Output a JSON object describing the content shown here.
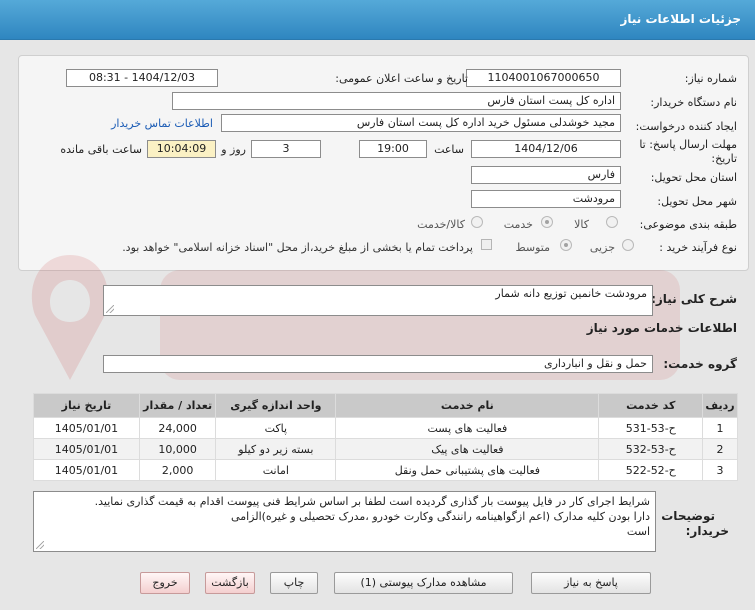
{
  "window": {
    "title": "جزئیات اطلاعات نیاز"
  },
  "form": {
    "need_number_label": "شماره نیاز:",
    "need_number": "1104001067000650",
    "announce_label": "تاریخ و ساعت اعلان عمومی:",
    "announce_value": "1404/12/03 - 08:31",
    "buyer_org_label": "نام دستگاه خریدار:",
    "buyer_org": "اداره کل پست استان فارس",
    "creator_label": "ایجاد کننده درخواست:",
    "creator": "مجید خوشدلی مسئول خرید اداره کل پست استان فارس",
    "contact_link": "اطلاعات تماس خریدار",
    "deadline_label_1": "مهلت ارسال پاسخ: تا",
    "deadline_label_2": "تاریخ:",
    "deadline_date": "1404/12/06",
    "time_label": "ساعت",
    "deadline_time": "19:00",
    "days_value": "3",
    "days_label": "روز و",
    "remaining_time": "10:04:09",
    "remaining_label": "ساعت باقی مانده",
    "province_label": "استان محل تحویل:",
    "province": "فارس",
    "city_label": "شهر محل تحویل:",
    "city": "مرودشت",
    "category_label": "طبقه بندی موضوعی:",
    "category_options": [
      "کالا",
      "خدمت",
      "کالا/خدمت"
    ],
    "category_selected": "خدمت",
    "process_label": "نوع فرآیند خرید :",
    "process_options": [
      "جزیی",
      "متوسط"
    ],
    "process_selected": "متوسط",
    "payment_note": "پرداخت تمام یا بخشی از مبلغ خرید،از محل \"اسناد خزانه اسلامی\" خواهد بود."
  },
  "summary": {
    "label": "شرح کلی نیاز:",
    "value": "مرودشت خانمین توزیع دانه شمار"
  },
  "services": {
    "section_title": "اطلاعات خدمات مورد نیاز",
    "group_label": "گروه خدمت:",
    "group_value": "حمل و نقل و انبارداری",
    "columns": [
      "ردیف",
      "کد خدمت",
      "نام خدمت",
      "واحد اندازه گیری",
      "تعداد / مقدار",
      "تاریخ نیاز"
    ],
    "rows": [
      {
        "row": "1",
        "code": "ح-53-531",
        "name": "فعالیت های پست",
        "unit": "پاکت",
        "qty": "24,000",
        "date": "1405/01/01"
      },
      {
        "row": "2",
        "code": "ح-53-532",
        "name": "فعالیت های پیک",
        "unit": "بسته زیر دو کیلو",
        "qty": "10,000",
        "date": "1405/01/01"
      },
      {
        "row": "3",
        "code": "ح-52-522",
        "name": "فعالیت های پشتیبانی حمل ونقل",
        "unit": "امانت",
        "qty": "2,000",
        "date": "1405/01/01"
      }
    ]
  },
  "notes": {
    "label_1": "توضیحات",
    "label_2": "خریدار:",
    "lines": [
      "شرایط اجرای کار در فایل پیوست بار گذاری گردیده است لطفا بر اساس شرایط فنی پیوست اقدام به قیمت گذاری نمایید.",
      "دارا بودن کلیه مدارک (اعم ازگواهینامه رانندگی وکارت خودرو ،مدرک تحصیلی و غیره)الزامی",
      "است"
    ]
  },
  "buttons": {
    "reply": "پاسخ به نیاز",
    "view_attachments": "مشاهده مدارک پیوستی (1)",
    "print": "چاپ",
    "back": "بازگشت",
    "exit": "خروج"
  },
  "colors": {
    "title_bar": "#3a93cc",
    "highlight": "#fbf1c4",
    "link": "#1a5bb5",
    "table_header": "#c9c9c9"
  }
}
